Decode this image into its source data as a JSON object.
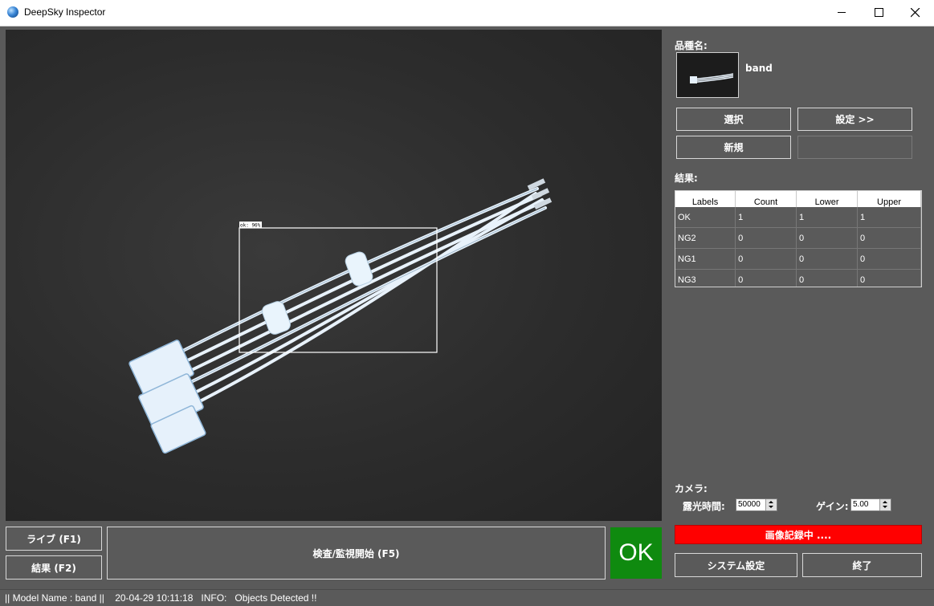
{
  "window": {
    "title": "DeepSky Inspector"
  },
  "camera": {
    "detection_label": "ok: 96%"
  },
  "controls": {
    "live_label": "ライブ (F1)",
    "result_label": "結果 (F2)",
    "inspect_label": "検査/監視開始 (F5)",
    "judgement": "OK",
    "judgement_color": "#0f8a0f"
  },
  "product": {
    "section_label": "品種名:",
    "name": "band",
    "select_label": "選択",
    "settings_label": "設定 >>",
    "new_label": "新規"
  },
  "results": {
    "section_label": "結果:",
    "columns": [
      "Labels",
      "Count",
      "Lower",
      "Upper"
    ],
    "rows": [
      [
        "OK",
        "1",
        "1",
        "1"
      ],
      [
        "NG2",
        "0",
        "0",
        "0"
      ],
      [
        "NG1",
        "0",
        "0",
        "0"
      ],
      [
        "NG3",
        "0",
        "0",
        "0"
      ]
    ]
  },
  "camera_settings": {
    "section_label": "カメラ:",
    "exposure_label": "露光時間:",
    "exposure_value": "50000",
    "gain_label": "ゲイン:",
    "gain_value": "5.00"
  },
  "recording": {
    "label": "画像記録中 ....",
    "color": "#ff0000"
  },
  "footer_buttons": {
    "system_settings_label": "システム設定",
    "exit_label": "終了"
  },
  "status": {
    "text": "|| Model Name : band ||    20-04-29 10:11:18   INFO:   Objects Detected !!"
  }
}
